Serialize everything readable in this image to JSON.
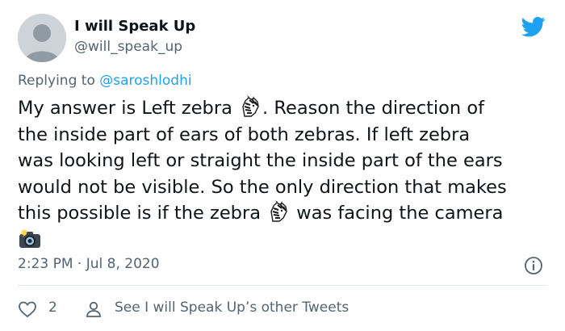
{
  "author": {
    "name": "I will Speak Up",
    "handle": "@will_speak_up"
  },
  "reply": {
    "prefix": "Replying to ",
    "mention": "@saroshlodhi"
  },
  "tweet": {
    "line1_a": "My answer is Left zebra ",
    "line1_b": ". Reason the direction of",
    "line2": "the inside part of ears of both zebras. If left zebra",
    "line3": "was looking left or straight the inside part of the ears",
    "line4": "would not be visible. So the only direction that makes",
    "line5_a": "this possible is if the zebra ",
    "line5_b": " was facing the camera",
    "emojis": [
      "zebra-emoji",
      "zebra-emoji",
      "camera-with-flash-emoji"
    ]
  },
  "meta": {
    "timestamp": "2:23 PM · Jul 8, 2020"
  },
  "actions": {
    "like_count": "2",
    "other_tweets": "See I will Speak Up’s other Tweets"
  },
  "colors": {
    "accent": "#1da1f2",
    "text": "#0f1419",
    "secondary": "#536471",
    "divider": "#e1e8ed"
  }
}
